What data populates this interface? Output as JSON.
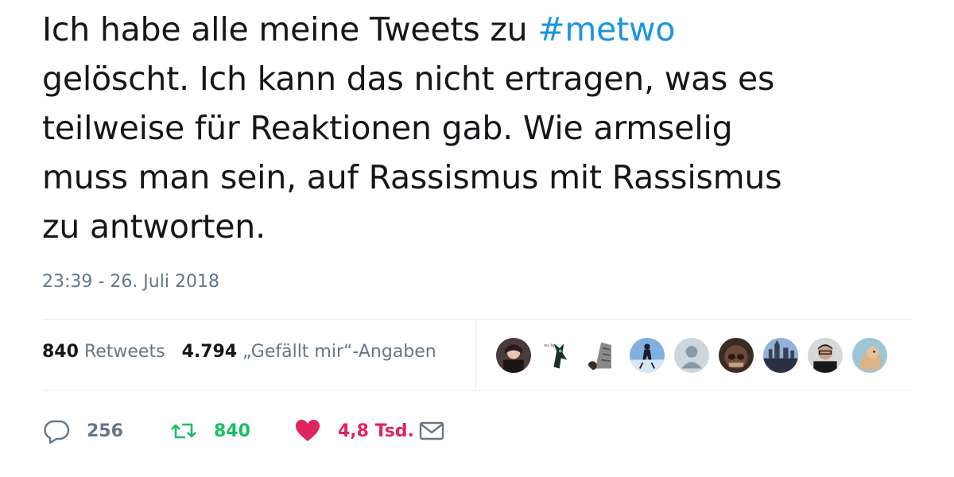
{
  "tweet": {
    "lines": [
      {
        "before": "Ich habe alle meine Tweets zu ",
        "hashtag": "#metwo"
      },
      {
        "text": "gelöscht. Ich kann das nicht ertragen, was es"
      },
      {
        "text": "teilweise für Reaktionen gab. Wie armselig"
      },
      {
        "text": "muss man sein, auf Rassismus mit Rassismus"
      },
      {
        "text": "zu antworten."
      }
    ],
    "timestamp": "23:39 - 26. Juli 2018"
  },
  "stats": {
    "retweets_count": "840",
    "retweets_label": "Retweets",
    "likes_count": "4.794",
    "likes_label": "„Gefällt mir“-Angaben"
  },
  "actions": {
    "reply_count": "256",
    "retweet_count": "840",
    "like_count": "4,8 Tsd."
  },
  "colors": {
    "text": "#14171a",
    "muted": "#657786",
    "link": "#1b95e0",
    "retweet": "#17bf63",
    "like": "#e0245e"
  },
  "icons": [
    "reply-icon",
    "retweet-icon",
    "heart-icon",
    "mail-icon"
  ]
}
